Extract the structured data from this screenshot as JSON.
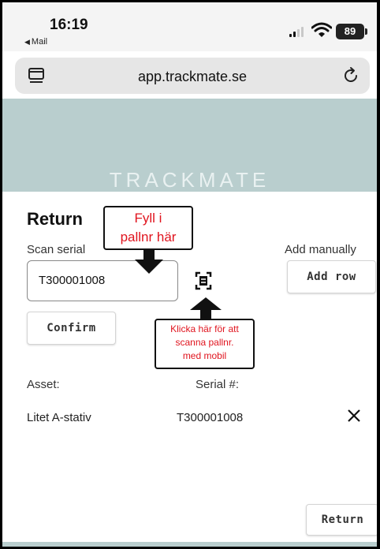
{
  "status_bar": {
    "time": "16:19",
    "back_app": "Mail",
    "battery": "89"
  },
  "browser": {
    "url": "app.trackmate.se",
    "tabs_icon": "tabs-icon",
    "reload_icon": "reload-icon"
  },
  "header": {
    "brand": "TRACKMATE",
    "color": "#b9cece"
  },
  "page": {
    "title": "Return",
    "scan_label": "Scan serial",
    "serial_value": "T300001008",
    "scan_icon": "scan-barcode-icon",
    "manual_label": "Add manually",
    "add_row_label": "Add row",
    "confirm_label": "Confirm",
    "table": {
      "columns": [
        "Asset:",
        "Serial #:"
      ],
      "rows": [
        {
          "asset": "Litet A-stativ",
          "serial": "T300001008",
          "remove_icon": "close-icon"
        }
      ]
    },
    "return_label": "Return"
  },
  "annotations": {
    "top_callout": [
      "Fyll i",
      "pallnr här"
    ],
    "bottom_callout": [
      "Klicka här för att",
      "scanna pallnr.",
      "med mobil"
    ],
    "color": "#e0141e"
  }
}
